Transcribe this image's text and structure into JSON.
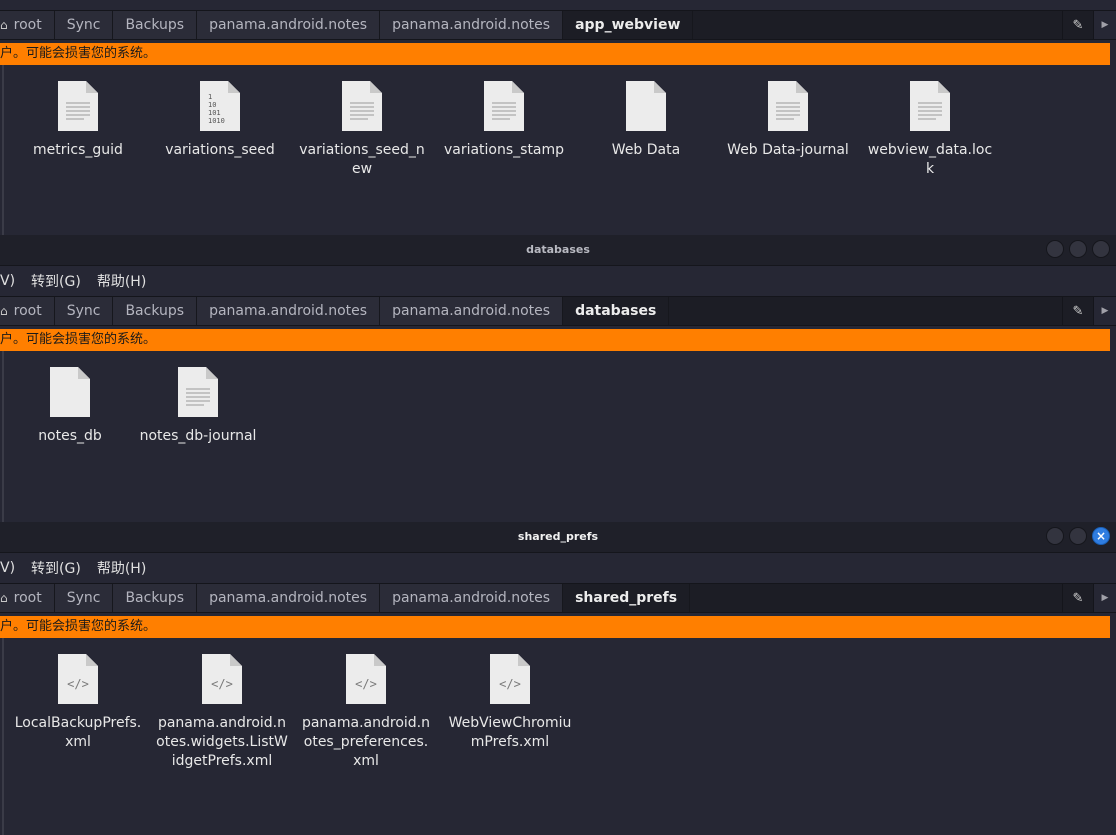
{
  "windows": [
    {
      "id": "app_webview",
      "title": "",
      "menu": [],
      "breadcrumbs": [
        "root",
        "Sync",
        "Backups",
        "panama.android.notes",
        "panama.android.notes",
        "app_webview"
      ],
      "warning": "户。可能会损害您的系统。",
      "files": [
        {
          "name": "metrics_guid",
          "icon": "text-file-icon"
        },
        {
          "name": "variations_seed",
          "icon": "binary-file-icon"
        },
        {
          "name": "variations_seed_new",
          "icon": "text-file-icon"
        },
        {
          "name": "variations_stamp",
          "icon": "text-file-icon"
        },
        {
          "name": "Web Data",
          "icon": "blank-file-icon"
        },
        {
          "name": "Web Data-journal",
          "icon": "text-file-icon"
        },
        {
          "name": "webview_data.lock",
          "icon": "text-file-icon"
        }
      ]
    },
    {
      "id": "databases",
      "title": "databases",
      "menu": [
        "V)",
        "转到(G)",
        "帮助(H)"
      ],
      "breadcrumbs": [
        "root",
        "Sync",
        "Backups",
        "panama.android.notes",
        "panama.android.notes",
        "databases"
      ],
      "warning": "户。可能会损害您的系统。",
      "files": [
        {
          "name": "notes_db",
          "icon": "blank-file-icon"
        },
        {
          "name": "notes_db-journal",
          "icon": "text-file-icon"
        }
      ]
    },
    {
      "id": "shared_prefs",
      "title": "shared_prefs",
      "menu": [
        "V)",
        "转到(G)",
        "帮助(H)"
      ],
      "breadcrumbs": [
        "root",
        "Sync",
        "Backups",
        "panama.android.notes",
        "panama.android.notes",
        "shared_prefs"
      ],
      "warning": "户。可能会损害您的系统。",
      "files": [
        {
          "name": "LocalBackupPrefs.xml",
          "icon": "xml-file-icon"
        },
        {
          "name": "panama.android.notes.widgets.ListWidgetPrefs.xml",
          "icon": "xml-file-icon"
        },
        {
          "name": "panama.android.notes_preferences.xml",
          "icon": "xml-file-icon"
        },
        {
          "name": "WebViewChromiumPrefs.xml",
          "icon": "xml-file-icon"
        }
      ]
    }
  ],
  "controls": {
    "close_glyph": "×"
  },
  "colors": {
    "warning": "#ff7f00",
    "accent_close": "#2f7de1"
  }
}
